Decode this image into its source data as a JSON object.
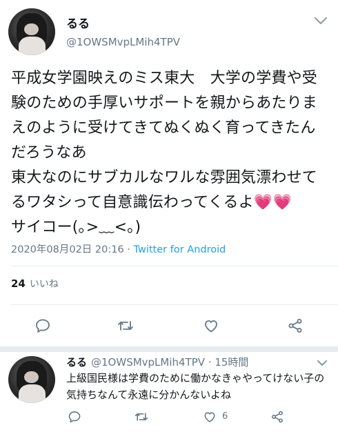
{
  "tweet": {
    "display_name": "るる",
    "handle": "@1OWSMvpLMih4TPV",
    "text": "平成女学園映えのミス東大　大学の学費や受験のための手厚いサポートを親からあたりまえのように受けてきてぬくぬく育ってきたんだろうなあ\n東大なのにサブカルなワルな雰囲気漂わせてるワタシって自意識伝わってくるよ💗💗\nサイコー(｡>﹏<｡)",
    "timestamp": "2020年08月02日 20:16 · ",
    "source": "Twitter for Android",
    "likes_count": "24",
    "likes_label": "いいね"
  },
  "reply": {
    "display_name": "るる",
    "handle_time": "@1OWSMvpLMih4TPV · 15時間",
    "text": "上級国民様は学費のために働かなきゃやってけない子の気持ちなんて永遠に分かんないよね",
    "like_count": "6"
  },
  "icons": [
    "chevron-down-icon",
    "reply-icon",
    "retweet-icon",
    "like-icon",
    "share-icon"
  ],
  "colors": {
    "accent": "#1da1f2",
    "text": "#14171a",
    "muted": "#657786",
    "icon": "#657786",
    "divider": "#e6ecf0"
  }
}
